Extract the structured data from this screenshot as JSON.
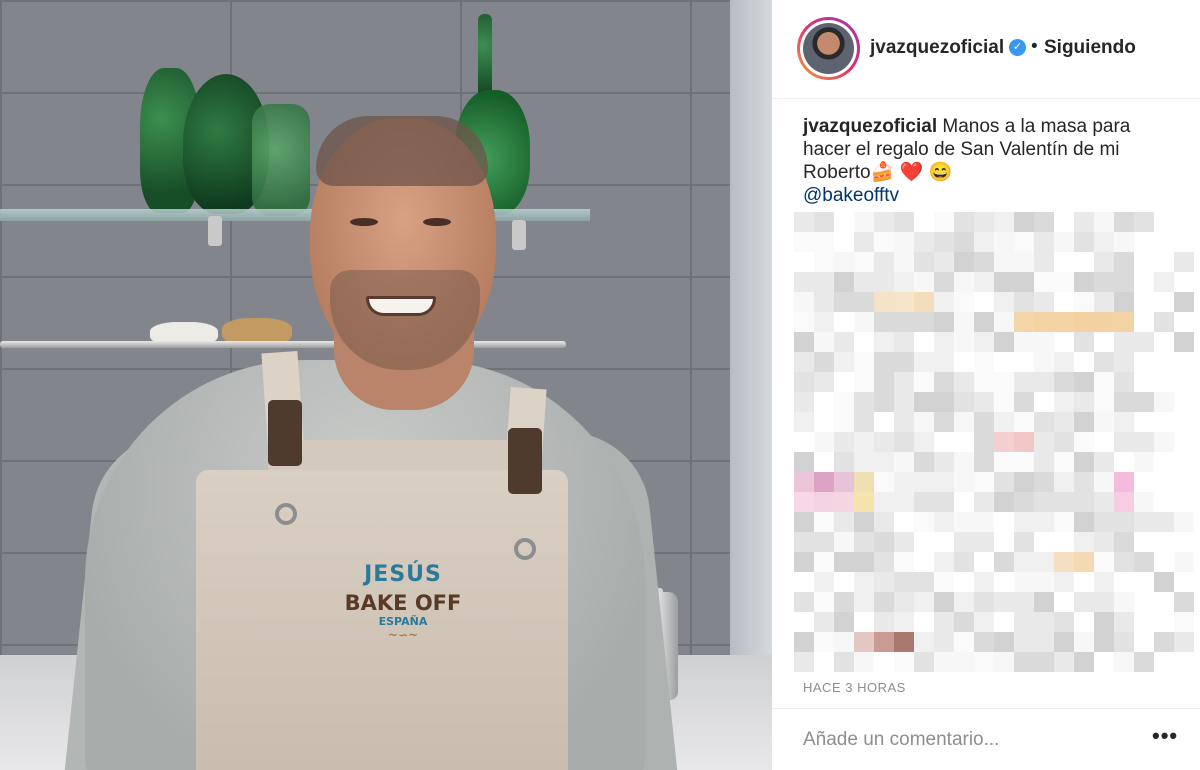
{
  "post": {
    "username": "jvazquezoficial",
    "verified_mark": "✓",
    "separator": "•",
    "follow_status": "Siguiendo",
    "caption_user": "jvazquezoficial",
    "caption_text": "Manos a la masa para hacer el regalo de San Valentín de mi Roberto",
    "caption_emojis": [
      "🍰",
      "❤️",
      "😄"
    ],
    "mention": "@bakeofftv",
    "time_ago": "HACE 3 HORAS",
    "comment_placeholder": "Añade un comentario...",
    "more_label": "•••"
  },
  "apron_logo": {
    "line1": "JESÚS",
    "line2": "BAKE OFF",
    "line3": "ESPAÑA",
    "ornament": "~∽~"
  },
  "icons": {
    "verified": "verified-badge-icon",
    "more": "more-options-icon"
  },
  "colors": {
    "verified_blue": "#3897f0",
    "mention_blue": "#003569",
    "muted_text": "#8e8e8e",
    "story_ring_start": "#f6a145",
    "story_ring_end": "#a032c2"
  }
}
